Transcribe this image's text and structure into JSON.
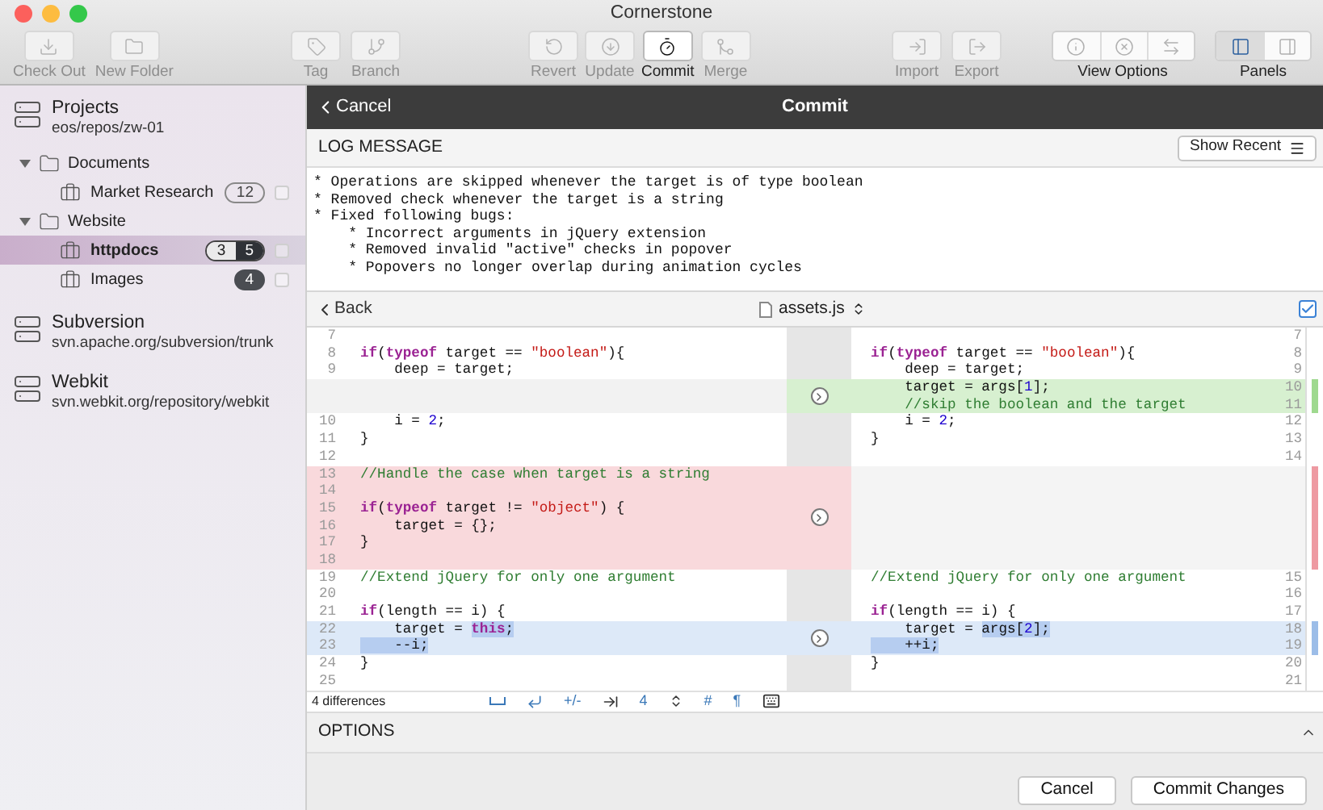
{
  "window": {
    "title": "Cornerstone"
  },
  "toolbar": {
    "groups": [
      {
        "kind": "buttons",
        "items": [
          {
            "label": "Check Out",
            "disabled": true
          },
          {
            "label": "New Folder",
            "disabled": true
          }
        ]
      },
      {
        "kind": "buttons",
        "items": [
          {
            "label": "Tag",
            "disabled": true
          },
          {
            "label": "Branch",
            "disabled": true
          }
        ]
      },
      {
        "kind": "buttons",
        "items": [
          {
            "label": "Revert",
            "disabled": true
          },
          {
            "label": "Update",
            "disabled": true
          },
          {
            "label": "Commit",
            "disabled": false
          },
          {
            "label": "Merge",
            "disabled": true
          }
        ]
      },
      {
        "kind": "buttons",
        "items": [
          {
            "label": "Import",
            "disabled": true
          },
          {
            "label": "Export",
            "disabled": true
          }
        ]
      },
      {
        "kind": "segmented",
        "label": "View Options",
        "segments": [
          {
            "selected": false
          },
          {
            "selected": false
          },
          {
            "selected": false
          }
        ]
      },
      {
        "kind": "segmented",
        "label": "Panels",
        "segments": [
          {
            "selected": true
          },
          {
            "selected": false
          }
        ]
      }
    ]
  },
  "sidebar": {
    "repositories": [
      {
        "name": "Projects",
        "path": "eos/repos/zw-01",
        "children": [
          {
            "label": "Documents",
            "expanded": true,
            "children": [
              {
                "label": "Market Research",
                "selected": false,
                "checked": false,
                "badges": [
                  {
                    "text": "12",
                    "kind": "outline"
                  }
                ]
              }
            ]
          },
          {
            "label": "Website",
            "expanded": true,
            "children": [
              {
                "label": "httpdocs",
                "selected": true,
                "checked": false,
                "badges": [
                  {
                    "text": "3",
                    "kind": "light"
                  },
                  {
                    "text": "5",
                    "kind": "dark"
                  }
                ]
              },
              {
                "label": "Images",
                "selected": false,
                "checked": false,
                "badges": [
                  {
                    "text": "4",
                    "kind": "dark"
                  }
                ]
              }
            ]
          }
        ]
      },
      {
        "name": "Subversion",
        "path": "svn.apache.org/subversion/trunk"
      },
      {
        "name": "Webkit",
        "path": "svn.webkit.org/repository/webkit"
      }
    ]
  },
  "commit_header": {
    "back": "Cancel",
    "title": "Commit"
  },
  "log_message": {
    "heading": "LOG MESSAGE",
    "button": "Show Recent",
    "lines": [
      "* Operations are skipped whenever the target is of type boolean",
      "* Removed check whenever the target is a string",
      "* Fixed following bugs:",
      "    * Incorrect arguments in jQuery extension",
      "    * Removed invalid \"active\" checks in popover",
      "    * Popovers no longer overlap during animation cycles"
    ]
  },
  "file_bar": {
    "back": "Back",
    "file": "assets.js",
    "checked": true
  },
  "diff": {
    "rows": [
      {
        "kind": "same",
        "left": {
          "number": "7"
        },
        "right": {
          "number": "7"
        }
      },
      {
        "kind": "same",
        "left": {
          "number": "8",
          "code": [
            {
              "text": "if",
              "kind": "keyword"
            },
            {
              "text": "(",
              "kind": "plain"
            },
            {
              "text": "typeof",
              "kind": "keyword"
            },
            {
              "text": " target == ",
              "kind": "plain"
            },
            {
              "text": "\"boolean\"",
              "kind": "string"
            },
            {
              "text": "){",
              "kind": "plain"
            }
          ]
        },
        "right": {
          "number": "8",
          "code": [
            {
              "text": "if",
              "kind": "keyword"
            },
            {
              "text": "(",
              "kind": "plain"
            },
            {
              "text": "typeof",
              "kind": "keyword"
            },
            {
              "text": " target == ",
              "kind": "plain"
            },
            {
              "text": "\"boolean\"",
              "kind": "string"
            },
            {
              "text": "){",
              "kind": "plain"
            }
          ]
        }
      },
      {
        "kind": "same",
        "left": {
          "number": "9",
          "code": [
            {
              "text": "    deep = target;",
              "kind": "plain"
            }
          ]
        },
        "right": {
          "number": "9",
          "code": [
            {
              "text": "    deep = target;",
              "kind": "plain"
            }
          ]
        }
      },
      {
        "kind": "added",
        "right": {
          "number": "10",
          "code": [
            {
              "text": "    target = args[",
              "kind": "plain"
            },
            {
              "text": "1",
              "kind": "number"
            },
            {
              "text": "];",
              "kind": "plain"
            }
          ]
        }
      },
      {
        "kind": "added",
        "right": {
          "number": "11",
          "code": [
            {
              "text": "    //skip the boolean and the target",
              "kind": "comment"
            }
          ]
        }
      },
      {
        "kind": "same",
        "left": {
          "number": "10",
          "code": [
            {
              "text": "    i = ",
              "kind": "plain"
            },
            {
              "text": "2",
              "kind": "number"
            },
            {
              "text": ";",
              "kind": "plain"
            }
          ]
        },
        "right": {
          "number": "12",
          "code": [
            {
              "text": "    i = ",
              "kind": "plain"
            },
            {
              "text": "2",
              "kind": "number"
            },
            {
              "text": ";",
              "kind": "plain"
            }
          ]
        }
      },
      {
        "kind": "same",
        "left": {
          "number": "11",
          "code": [
            {
              "text": "}",
              "kind": "plain"
            }
          ]
        },
        "right": {
          "number": "13",
          "code": [
            {
              "text": "}",
              "kind": "plain"
            }
          ]
        }
      },
      {
        "kind": "same",
        "left": {
          "number": "12"
        },
        "right": {
          "number": "14"
        }
      },
      {
        "kind": "removed",
        "left": {
          "number": "13",
          "code": [
            {
              "text": "//Handle the case when target is a string",
              "kind": "comment"
            }
          ]
        }
      },
      {
        "kind": "removed",
        "left": {
          "number": "14"
        }
      },
      {
        "kind": "removed",
        "left": {
          "number": "15",
          "code": [
            {
              "text": "if",
              "kind": "keyword"
            },
            {
              "text": "(",
              "kind": "plain"
            },
            {
              "text": "typeof",
              "kind": "keyword"
            },
            {
              "text": " target != ",
              "kind": "plain"
            },
            {
              "text": "\"object\"",
              "kind": "string"
            },
            {
              "text": ") {",
              "kind": "plain"
            }
          ]
        }
      },
      {
        "kind": "removed",
        "left": {
          "number": "16",
          "code": [
            {
              "text": "    target = {};",
              "kind": "plain"
            }
          ]
        }
      },
      {
        "kind": "removed",
        "left": {
          "number": "17",
          "code": [
            {
              "text": "}",
              "kind": "plain"
            }
          ]
        }
      },
      {
        "kind": "removed",
        "left": {
          "number": "18"
        }
      },
      {
        "kind": "same",
        "left": {
          "number": "19",
          "code": [
            {
              "text": "//Extend jQuery for only one argument",
              "kind": "comment"
            }
          ]
        },
        "right": {
          "number": "15",
          "code": [
            {
              "text": "//Extend jQuery for only one argument",
              "kind": "comment"
            }
          ]
        }
      },
      {
        "kind": "same",
        "left": {
          "number": "20"
        },
        "right": {
          "number": "16"
        }
      },
      {
        "kind": "same",
        "left": {
          "number": "21",
          "code": [
            {
              "text": "if",
              "kind": "keyword"
            },
            {
              "text": "(length == i) {",
              "kind": "plain"
            }
          ]
        },
        "right": {
          "number": "17",
          "code": [
            {
              "text": "if",
              "kind": "keyword"
            },
            {
              "text": "(length == i) {",
              "kind": "plain"
            }
          ]
        }
      },
      {
        "kind": "changed",
        "left": {
          "number": "22",
          "code": [
            {
              "text": "    target = ",
              "kind": "plain",
              "changed": false
            },
            {
              "text": "this",
              "kind": "keyword",
              "changed": true
            },
            {
              "text": ";",
              "kind": "plain",
              "changed": true
            }
          ]
        },
        "right": {
          "number": "18",
          "code": [
            {
              "text": "    target = ",
              "kind": "plain",
              "changed": false
            },
            {
              "text": "args[",
              "kind": "plain",
              "changed": true
            },
            {
              "text": "2",
              "kind": "number",
              "changed": true
            },
            {
              "text": "];",
              "kind": "plain",
              "changed": true
            }
          ]
        }
      },
      {
        "kind": "changed",
        "left": {
          "number": "23",
          "code": [
            {
              "text": "    --i;",
              "kind": "plain",
              "changed": true
            }
          ]
        },
        "right": {
          "number": "19",
          "code": [
            {
              "text": "    ++i;",
              "kind": "plain",
              "changed": true
            }
          ]
        }
      },
      {
        "kind": "same",
        "left": {
          "number": "24",
          "code": [
            {
              "text": "}",
              "kind": "plain"
            }
          ]
        },
        "right": {
          "number": "20",
          "code": [
            {
              "text": "}",
              "kind": "plain"
            }
          ]
        }
      },
      {
        "kind": "same",
        "left": {
          "number": "25"
        },
        "right": {
          "number": "21"
        }
      }
    ]
  },
  "diff_footer": {
    "summary": "4 differences",
    "tools": [
      {
        "kind": "space"
      },
      {
        "kind": "return"
      },
      {
        "kind": "text",
        "text": "+/-"
      },
      {
        "kind": "tab"
      },
      {
        "kind": "text",
        "text": "4"
      },
      {
        "kind": "stepper"
      },
      {
        "kind": "text",
        "text": "#"
      },
      {
        "kind": "text",
        "text": "¶"
      },
      {
        "kind": "keyboard"
      }
    ]
  },
  "options": {
    "heading": "OPTIONS"
  },
  "buttons": [
    "Cancel",
    "Commit Changes"
  ]
}
